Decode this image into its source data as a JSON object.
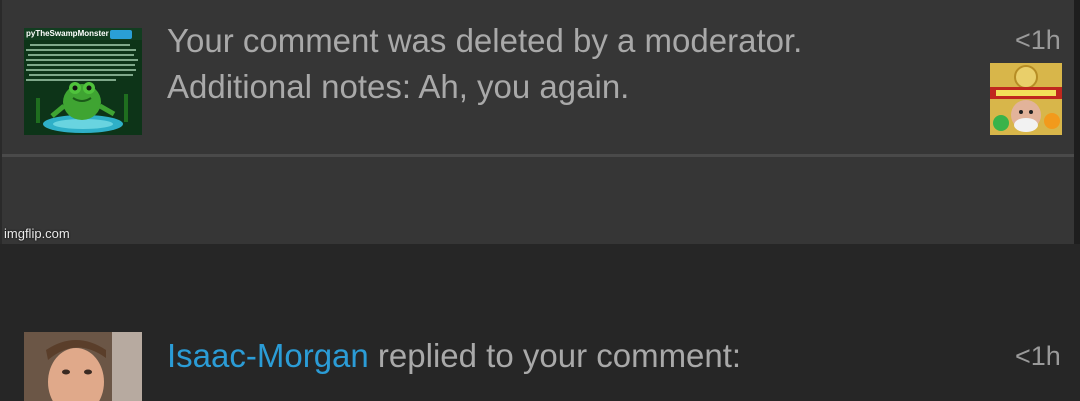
{
  "notifications": [
    {
      "line1": "Your comment was deleted by a moderator.",
      "line2": "Additional notes: Ah, you again.",
      "time": "<1h",
      "thumbnail": {
        "username": "pyTheSwampMonster",
        "icon": "frog-meme-thumbnail"
      },
      "meme_icon": "old-man-meme-thumbnail"
    },
    {
      "user": "Isaac-Morgan",
      "text": " replied to your comment:",
      "time": "<1h",
      "avatar_icon": "user-avatar-photo"
    }
  ],
  "watermark": "imgflip.com",
  "colors": {
    "background": "#363636",
    "text": "#a9a9a9",
    "link": "#2b9cd6",
    "divider": "#4a4a4a"
  }
}
